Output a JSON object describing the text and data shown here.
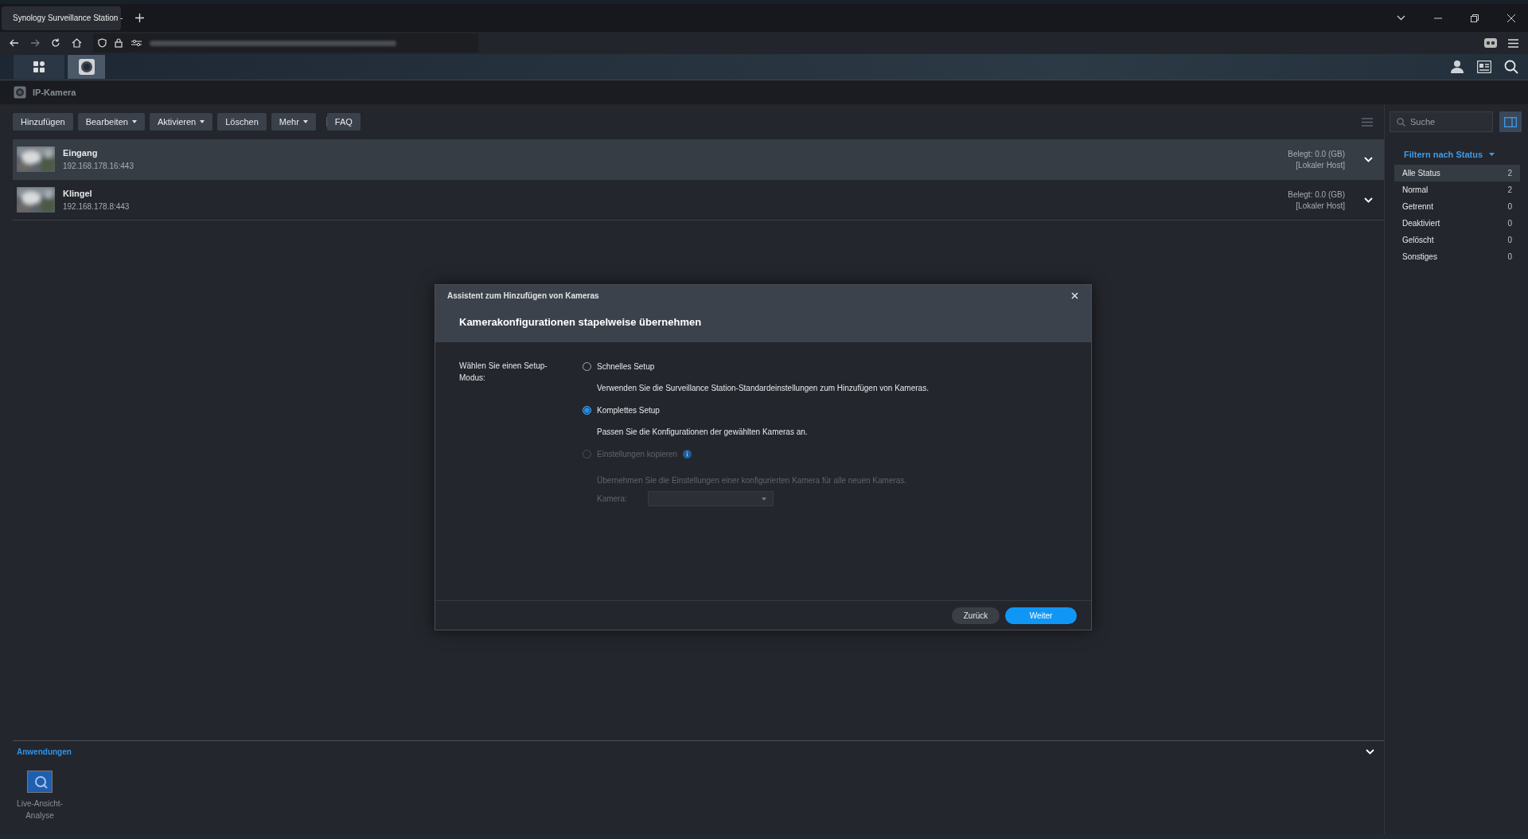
{
  "browser": {
    "tab_title": "Synology Surveillance Station -"
  },
  "app": {
    "title": "IP-Kamera",
    "toolbar": [
      {
        "label": "Hinzufügen",
        "dropdown": false,
        "separated": false
      },
      {
        "label": "Bearbeiten",
        "dropdown": true,
        "separated": false
      },
      {
        "label": "Aktivieren",
        "dropdown": true,
        "separated": false
      },
      {
        "label": "Löschen",
        "dropdown": false,
        "separated": false
      },
      {
        "label": "Mehr",
        "dropdown": true,
        "separated": false
      },
      {
        "label": "FAQ",
        "dropdown": false,
        "separated": true
      }
    ],
    "search": {
      "placeholder": "Suche"
    },
    "cameras": [
      {
        "name": "Eingang",
        "address": "192.168.178.16:443",
        "usage": "Belegt: 0.0 (GB)",
        "host": "[Lokaler Host]",
        "selected": true
      },
      {
        "name": "Klingel",
        "address": "192.168.178.8:443",
        "usage": "Belegt: 0.0 (GB)",
        "host": "[Lokaler Host]",
        "selected": false
      }
    ],
    "filter": {
      "title": "Filtern nach Status",
      "items": [
        {
          "label": "Alle Status",
          "count": "2",
          "selected": true
        },
        {
          "label": "Normal",
          "count": "2",
          "selected": false
        },
        {
          "label": "Getrennt",
          "count": "0",
          "selected": false
        },
        {
          "label": "Deaktiviert",
          "count": "0",
          "selected": false
        },
        {
          "label": "Gelöscht",
          "count": "0",
          "selected": false
        },
        {
          "label": "Sonstiges",
          "count": "0",
          "selected": false
        }
      ]
    },
    "applications": {
      "title": "Anwendungen",
      "items": [
        {
          "label": "Live-Ansicht-Analyse"
        }
      ]
    }
  },
  "dialog": {
    "window_title": "Assistent zum Hinzufügen von Kameras",
    "heading": "Kamerakonfigurationen stapelweise übernehmen",
    "field_label": "Wählen Sie einen Setup-Modus:",
    "options": [
      {
        "label": "Schnelles Setup",
        "description": "Verwenden Sie die Surveillance Station-Standardeinstellungen zum Hinzufügen von Kameras.",
        "selected": false,
        "disabled": false,
        "info": false
      },
      {
        "label": "Komplettes Setup",
        "description": "Passen Sie die Konfigurationen der gewählten Kameras an.",
        "selected": true,
        "disabled": false,
        "info": false
      },
      {
        "label": "Einstellungen kopieren",
        "description": "Übernehmen Sie die Einstellungen einer konfigurierten Kamera für alle neuen Kameras.",
        "selected": false,
        "disabled": true,
        "info": true
      }
    ],
    "camera_field": {
      "label": "Kamera:",
      "disabled": true
    },
    "buttons": [
      {
        "label": "Zurück",
        "kind": "secondary"
      },
      {
        "label": "Weiter",
        "kind": "primary"
      }
    ]
  }
}
